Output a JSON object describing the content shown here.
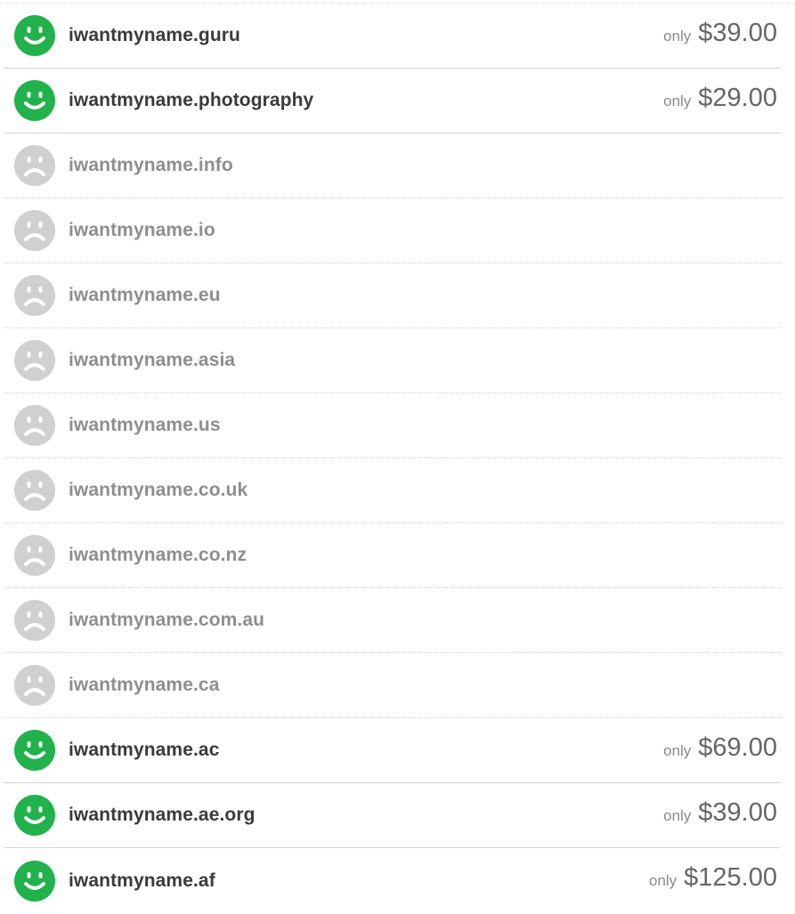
{
  "colors": {
    "available_icon": "#21b24b",
    "taken_icon": "#d0d0d0",
    "domain_available_text": "#3a3a3a",
    "domain_taken_text": "#8e8e8e",
    "price_text": "#666666"
  },
  "results": [
    {
      "domain": "iwantmyname.guru",
      "status": "available",
      "icon": "smiley-icon",
      "only_label": "only",
      "price": "$39.00"
    },
    {
      "domain": "iwantmyname.photography",
      "status": "available",
      "icon": "smiley-icon",
      "only_label": "only",
      "price": "$29.00"
    },
    {
      "domain": "iwantmyname.info",
      "status": "taken",
      "icon": "frowny-icon"
    },
    {
      "domain": "iwantmyname.io",
      "status": "taken",
      "icon": "frowny-icon"
    },
    {
      "domain": "iwantmyname.eu",
      "status": "taken",
      "icon": "frowny-icon"
    },
    {
      "domain": "iwantmyname.asia",
      "status": "taken",
      "icon": "frowny-icon"
    },
    {
      "domain": "iwantmyname.us",
      "status": "taken",
      "icon": "frowny-icon"
    },
    {
      "domain": "iwantmyname.co.uk",
      "status": "taken",
      "icon": "frowny-icon"
    },
    {
      "domain": "iwantmyname.co.nz",
      "status": "taken",
      "icon": "frowny-icon"
    },
    {
      "domain": "iwantmyname.com.au",
      "status": "taken",
      "icon": "frowny-icon"
    },
    {
      "domain": "iwantmyname.ca",
      "status": "taken",
      "icon": "frowny-icon"
    },
    {
      "domain": "iwantmyname.ac",
      "status": "available",
      "icon": "smiley-icon",
      "only_label": "only",
      "price": "$69.00"
    },
    {
      "domain": "iwantmyname.ae.org",
      "status": "available",
      "icon": "smiley-icon",
      "only_label": "only",
      "price": "$39.00"
    },
    {
      "domain": "iwantmyname.af",
      "status": "available",
      "icon": "smiley-icon",
      "only_label": "only",
      "price": "$125.00"
    }
  ]
}
